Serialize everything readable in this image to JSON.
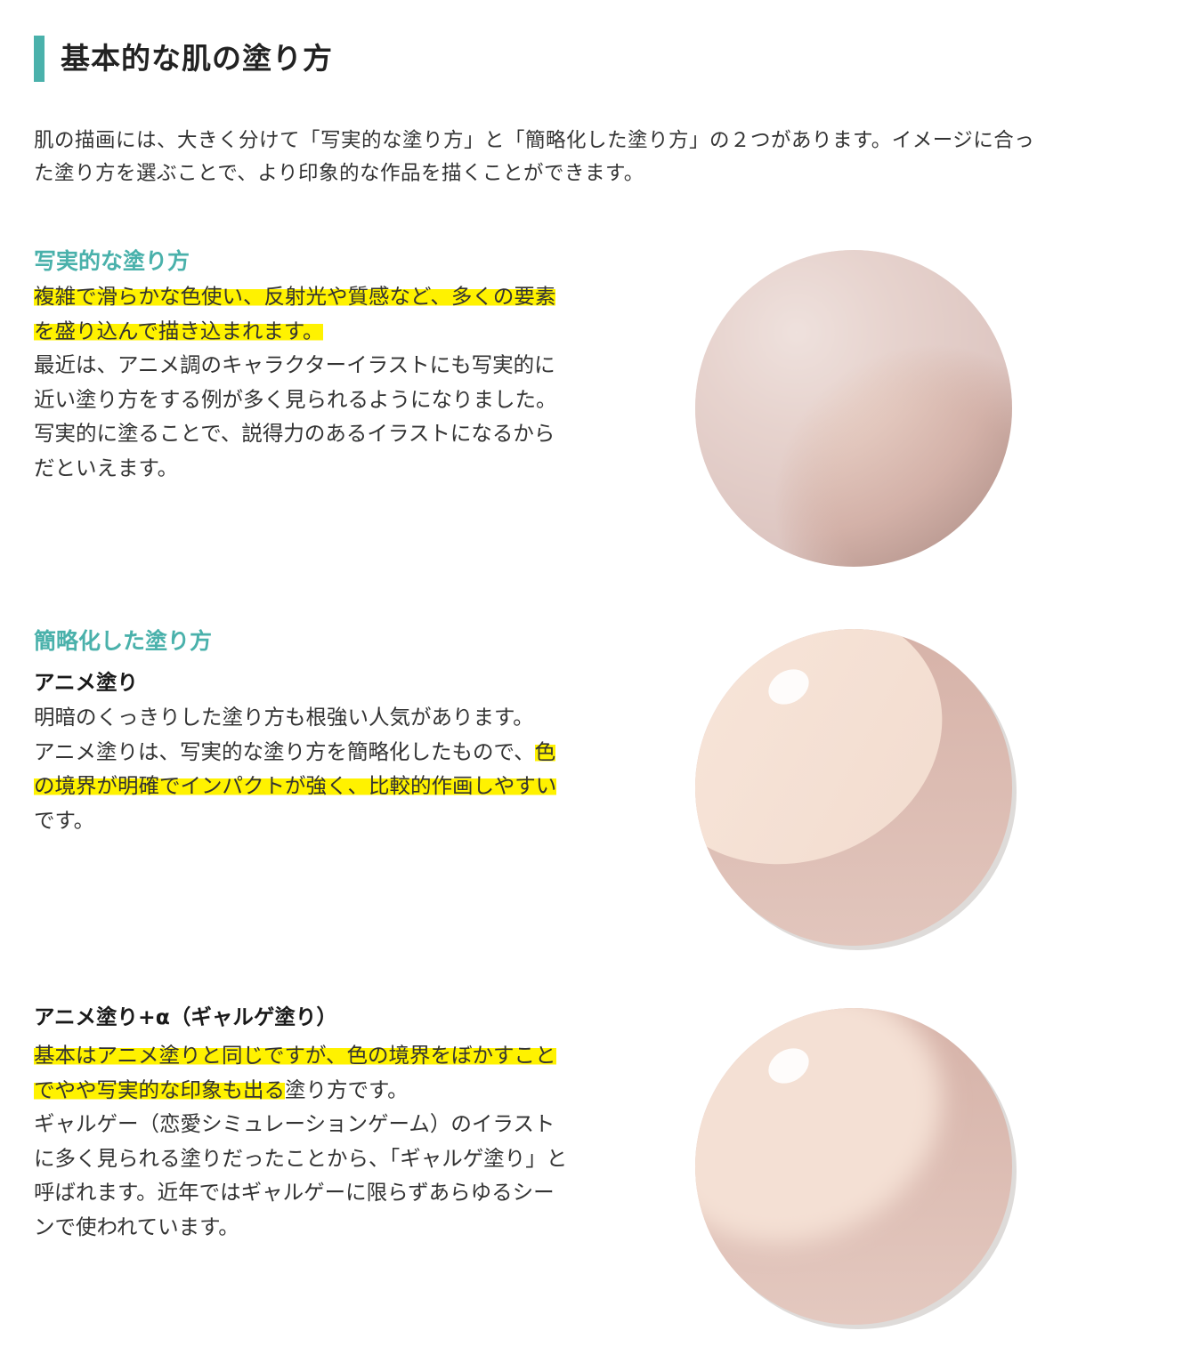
{
  "title": "基本的な肌の塗り方",
  "intro": [
    "肌の描画には、大きく分けて「写実的な塗り方」と「簡略化した塗り方」の２つがあります。イメージに合っ",
    "た塗り方を選ぶことで、より印象的な作品を描くことができます。"
  ],
  "realistic": {
    "heading": "写実的な塗り方",
    "lines": [
      {
        "hl": "複雑で滑らかな色使い、反射光や質感など、多くの要素",
        "rest": ""
      },
      {
        "hl": "を盛り込んで描き込まれます。",
        "rest": ""
      },
      {
        "pre": "",
        "hl": "",
        "rest": "最近は、アニメ調のキャラクターイラストにも写実的に"
      },
      {
        "pre": "",
        "hl": "",
        "rest": "近い塗り方をする例が多く見られるようになりました。"
      },
      {
        "pre": "",
        "hl": "",
        "rest": "写実的に塗ることで、説得力のあるイラストになるから"
      },
      {
        "pre": "",
        "hl": "",
        "rest": "だといえます。"
      }
    ]
  },
  "simplified": {
    "heading": "簡略化した塗り方",
    "anime": {
      "subheading": "アニメ塗り",
      "lines": [
        {
          "pre": "明暗のくっきりした塗り方も根強い人気があります。",
          "hl": "",
          "rest": ""
        },
        {
          "pre": "アニメ塗りは、写実的な塗り方を簡略化したもので、",
          "hl": "色",
          "rest": ""
        },
        {
          "pre": "",
          "hl": "の境界が明確でインパクトが強く、比較的作画しやすい",
          "rest": ""
        },
        {
          "pre": "です。",
          "hl": "",
          "rest": ""
        }
      ]
    },
    "galge": {
      "subheading": "アニメ塗り+α（ギャルゲ塗り）",
      "lines": [
        {
          "pre": "",
          "hl": "基本はアニメ塗りと同じですが、色の境界をぼかすこと",
          "rest": ""
        },
        {
          "pre": "",
          "hl": "でやや写実的な印象も出る",
          "rest": "塗り方です。"
        },
        {
          "pre": "ギャルゲー（恋愛シミュレーションゲーム）のイラスト",
          "hl": "",
          "rest": ""
        },
        {
          "pre": "に多く見られる塗りだったことから、「ギャルゲ塗り」と",
          "hl": "",
          "rest": ""
        },
        {
          "pre": "呼ばれます。近年ではギャルゲーに限らずあらゆるシー",
          "hl": "",
          "rest": ""
        },
        {
          "pre": "ンで使われています。",
          "hl": "",
          "rest": ""
        }
      ]
    }
  },
  "colors": {
    "accent": "#4ab1ab",
    "highlight": "#fff200",
    "skin_light": "#f6e3d8",
    "skin_mid": "#e3c6bb",
    "skin_shadow": "#c7a39a"
  }
}
